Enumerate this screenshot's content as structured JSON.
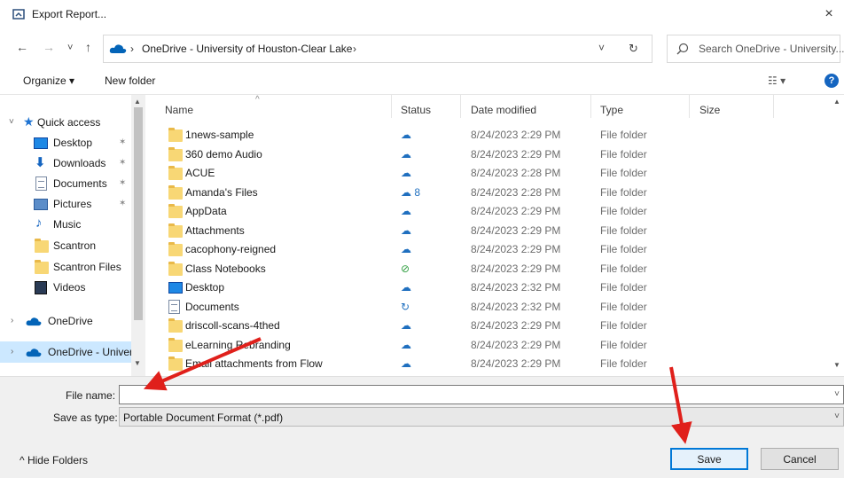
{
  "window": {
    "title": "Export Report...",
    "close": "×"
  },
  "nav": {
    "back": "←",
    "forward": "→",
    "recent": "˅",
    "up": "↑"
  },
  "address": {
    "separator": "›",
    "path": "OneDrive - University of Houston-Clear Lake",
    "dropdown": "˅",
    "refresh": "↻"
  },
  "search": {
    "placeholder": "Search OneDrive - University..."
  },
  "toolbar": {
    "organize": "Organize ▾",
    "new_folder": "New folder",
    "view": "☷ ▾",
    "help": "?"
  },
  "sidebar": {
    "quick_access": "Quick access",
    "items": [
      {
        "label": "Desktop",
        "icon": "desktop-icon",
        "pinned": true
      },
      {
        "label": "Downloads",
        "icon": "downloads-icon",
        "pinned": true
      },
      {
        "label": "Documents",
        "icon": "documents-icon",
        "pinned": true
      },
      {
        "label": "Pictures",
        "icon": "pictures-icon",
        "pinned": true
      },
      {
        "label": "Music",
        "icon": "music-icon",
        "pinned": false
      },
      {
        "label": "Scantron",
        "icon": "folder-icon",
        "pinned": false
      },
      {
        "label": "Scantron Files",
        "icon": "folder-icon",
        "pinned": false
      },
      {
        "label": "Videos",
        "icon": "videos-icon",
        "pinned": false
      }
    ],
    "onedrive": "OneDrive",
    "onedrive_univ": "OneDrive - Univer"
  },
  "columns": {
    "name": "Name",
    "status": "Status",
    "date": "Date modified",
    "type": "Type",
    "size": "Size"
  },
  "files": [
    {
      "name": "1news-sample",
      "status": "☁",
      "date": "8/24/2023 2:29 PM",
      "type": "File folder",
      "icon": "folder"
    },
    {
      "name": "360 demo Audio",
      "status": "☁",
      "date": "8/24/2023 2:29 PM",
      "type": "File folder",
      "icon": "folder"
    },
    {
      "name": "ACUE",
      "status": "☁",
      "date": "8/24/2023 2:28 PM",
      "type": "File folder",
      "icon": "folder"
    },
    {
      "name": "Amanda's Files",
      "status": "☁ 8",
      "date": "8/24/2023 2:28 PM",
      "type": "File folder",
      "icon": "folder"
    },
    {
      "name": "AppData",
      "status": "☁",
      "date": "8/24/2023 2:29 PM",
      "type": "File folder",
      "icon": "folder"
    },
    {
      "name": "Attachments",
      "status": "☁",
      "date": "8/24/2023 2:29 PM",
      "type": "File folder",
      "icon": "folder"
    },
    {
      "name": "cacophony-reigned",
      "status": "☁",
      "date": "8/24/2023 2:29 PM",
      "type": "File folder",
      "icon": "folder"
    },
    {
      "name": "Class Notebooks",
      "status": "⊘",
      "date": "8/24/2023 2:29 PM",
      "type": "File folder",
      "icon": "folder"
    },
    {
      "name": "Desktop",
      "status": "☁",
      "date": "8/24/2023 2:32 PM",
      "type": "File folder",
      "icon": "desktop"
    },
    {
      "name": "Documents",
      "status": "↻",
      "date": "8/24/2023 2:32 PM",
      "type": "File folder",
      "icon": "document"
    },
    {
      "name": "driscoll-scans-4thed",
      "status": "☁",
      "date": "8/24/2023 2:29 PM",
      "type": "File folder",
      "icon": "folder"
    },
    {
      "name": "eLearning Rebranding",
      "status": "☁",
      "date": "8/24/2023 2:29 PM",
      "type": "File folder",
      "icon": "folder"
    },
    {
      "name": "Email attachments from Flow",
      "status": "☁",
      "date": "8/24/2023 2:29 PM",
      "type": "File folder",
      "icon": "folder"
    }
  ],
  "form": {
    "file_name_label": "File name:",
    "file_name_value": "",
    "save_type_label": "Save as type:",
    "save_type_value": "Portable Document Format (*.pdf)",
    "dropdown_arrow": "˅"
  },
  "footer": {
    "hide_folders": "^  Hide Folders",
    "save": "Save",
    "cancel": "Cancel"
  },
  "colors": {
    "accent": "#0078d7",
    "arrow": "#e0201b",
    "selected": "#cce8ff"
  }
}
